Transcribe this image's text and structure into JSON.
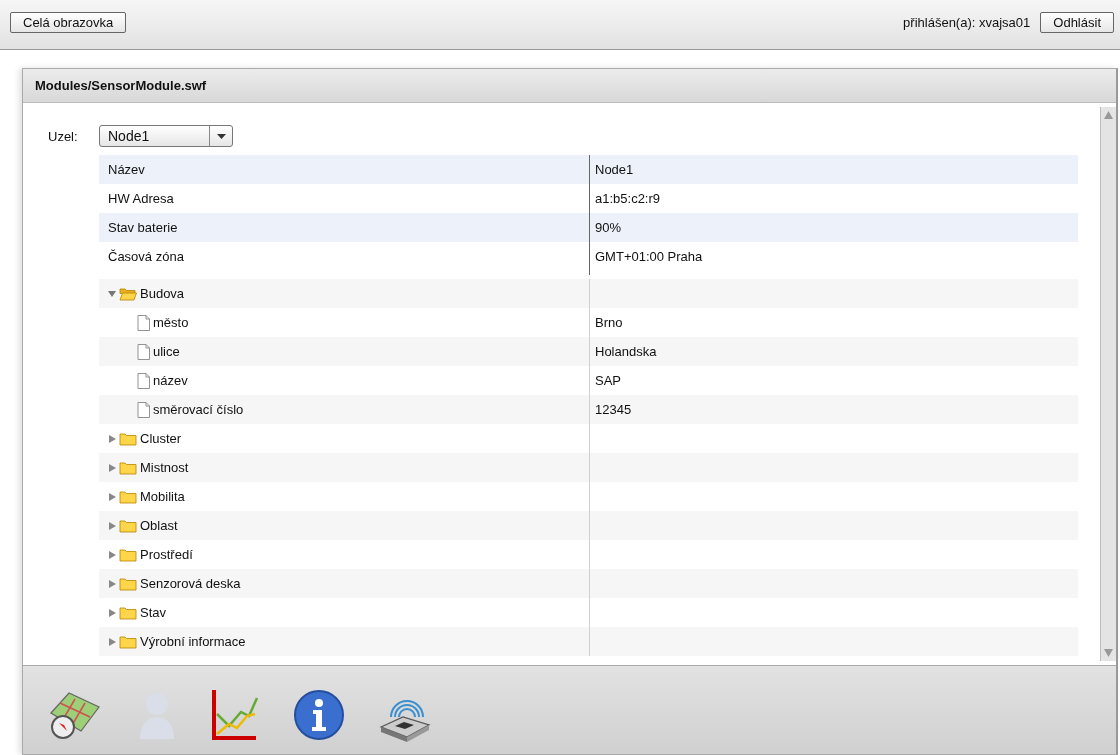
{
  "top_bar": {
    "fullscreen_button": "Celá obrazovka",
    "user_label": "přihlášen(a): xvajsa01",
    "logout_button": "Odhlásit"
  },
  "panel": {
    "title": "Modules/SensorModule.swf",
    "node_select": {
      "label": "Uzel:",
      "value": "Node1"
    },
    "properties": [
      {
        "name": "Název",
        "value": "Node1"
      },
      {
        "name": "HW Adresa",
        "value": "a1:b5:c2:r9"
      },
      {
        "name": "Stav baterie",
        "value": "90%"
      },
      {
        "name": "Časová zóna",
        "value": "GMT+01:00 Praha"
      }
    ],
    "tree": [
      {
        "label": "Budova",
        "expanded": true,
        "children": [
          {
            "label": "město",
            "value": "Brno"
          },
          {
            "label": "ulice",
            "value": "Holandska"
          },
          {
            "label": "název",
            "value": "SAP"
          },
          {
            "label": "směrovací číslo",
            "value": "12345"
          }
        ]
      },
      {
        "label": "Cluster",
        "expanded": false
      },
      {
        "label": "Mistnost",
        "expanded": false
      },
      {
        "label": "Mobilita",
        "expanded": false
      },
      {
        "label": "Oblast",
        "expanded": false
      },
      {
        "label": "Prostředí",
        "expanded": false
      },
      {
        "label": "Senzorová deska",
        "expanded": false
      },
      {
        "label": "Stav",
        "expanded": false
      },
      {
        "label": "Výrobní informace",
        "expanded": false
      }
    ]
  }
}
